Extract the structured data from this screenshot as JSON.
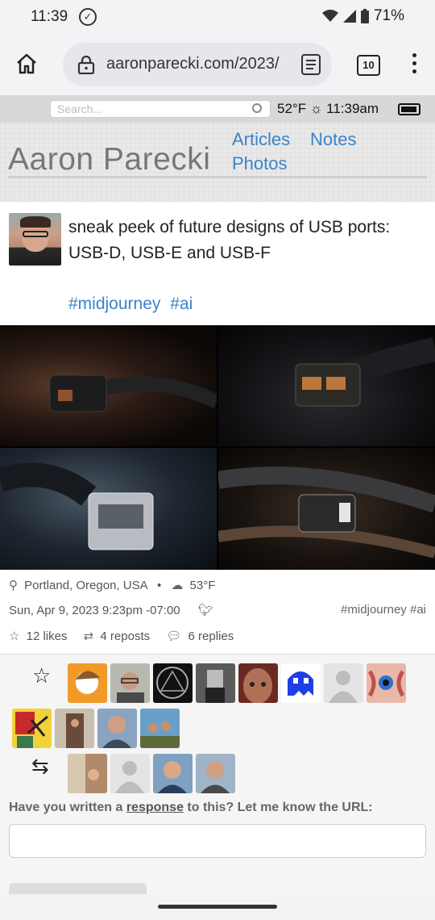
{
  "status": {
    "time": "11:39",
    "battery": "71%"
  },
  "browser": {
    "url": "aaronparecki.com/2023/",
    "tab_count": "10"
  },
  "site": {
    "search_placeholder": "Search...",
    "weather": "52°F",
    "clock": "11:39am",
    "name": "Aaron Parecki",
    "nav": {
      "articles": "Articles",
      "notes": "Notes",
      "photos": "Photos"
    }
  },
  "post": {
    "text": "sneak peek of future designs of USB ports: USB-D, USB-E and USB-F",
    "tags": [
      "#midjourney",
      "#ai"
    ],
    "location": "Portland, Oregon, USA",
    "temp": "53°F",
    "date": "Sun, Apr 9, 2023 9:23pm -07:00",
    "meta_tags": "#midjourney #ai",
    "likes": "12 likes",
    "reposts": "4 reposts",
    "replies": "6 replies"
  },
  "response": {
    "prefix": "Have you written a ",
    "link": "response",
    "suffix": " to this? Let me know the URL:"
  },
  "colors": {
    "link": "#3a84c9",
    "header_bg": "#e9e9e9"
  },
  "icons": [
    "home-icon",
    "lock-icon",
    "reader-mode-icon",
    "menu-icon",
    "search-icon",
    "sun-icon",
    "battery-icon",
    "location-icon",
    "cloud-icon",
    "twitter-icon",
    "star-icon",
    "repost-icon",
    "reply-icon"
  ]
}
